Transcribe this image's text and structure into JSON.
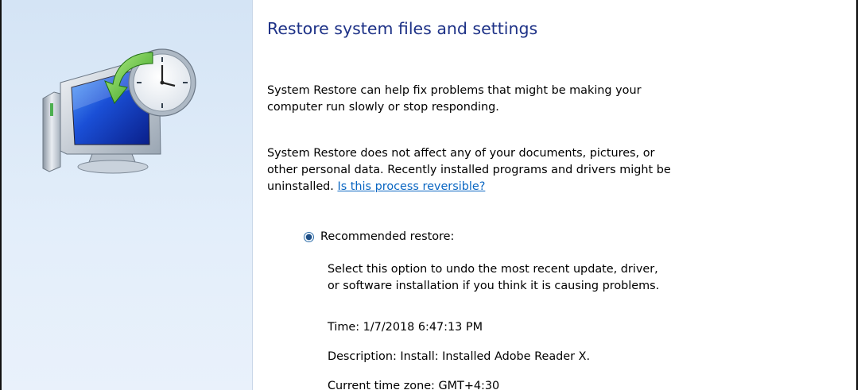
{
  "dialog": {
    "title": "Restore system files and settings",
    "intro": "System Restore can help fix problems that might be making your\ncomputer run slowly or stop responding.",
    "info_text": "System Restore does not affect any of your documents, pictures, or\nother personal data. Recently installed programs and drivers might be\nuninstalled. ",
    "info_link": "Is this process reversible?",
    "option": {
      "label": "Recommended restore:",
      "selected": true,
      "description": "Select this option to undo the most recent update, driver,\nor software installation if you think it is causing problems."
    },
    "restore_point": {
      "time_label": "Time:",
      "time_value": "1/7/2018 6:47:13 PM",
      "description_label": "Description:",
      "description_value": "Install: Installed Adobe Reader X.",
      "timezone_label": "Current time zone:",
      "timezone_value": "GMT+4:30"
    }
  },
  "icons": {
    "sidebar": "system-restore-icon",
    "radio": "radio-button-selected-icon"
  },
  "colors": {
    "title": "#1e3287",
    "link": "#0a66c2",
    "sidebar_top": "#d4e4f5",
    "sidebar_bottom": "#e9f1fb"
  }
}
